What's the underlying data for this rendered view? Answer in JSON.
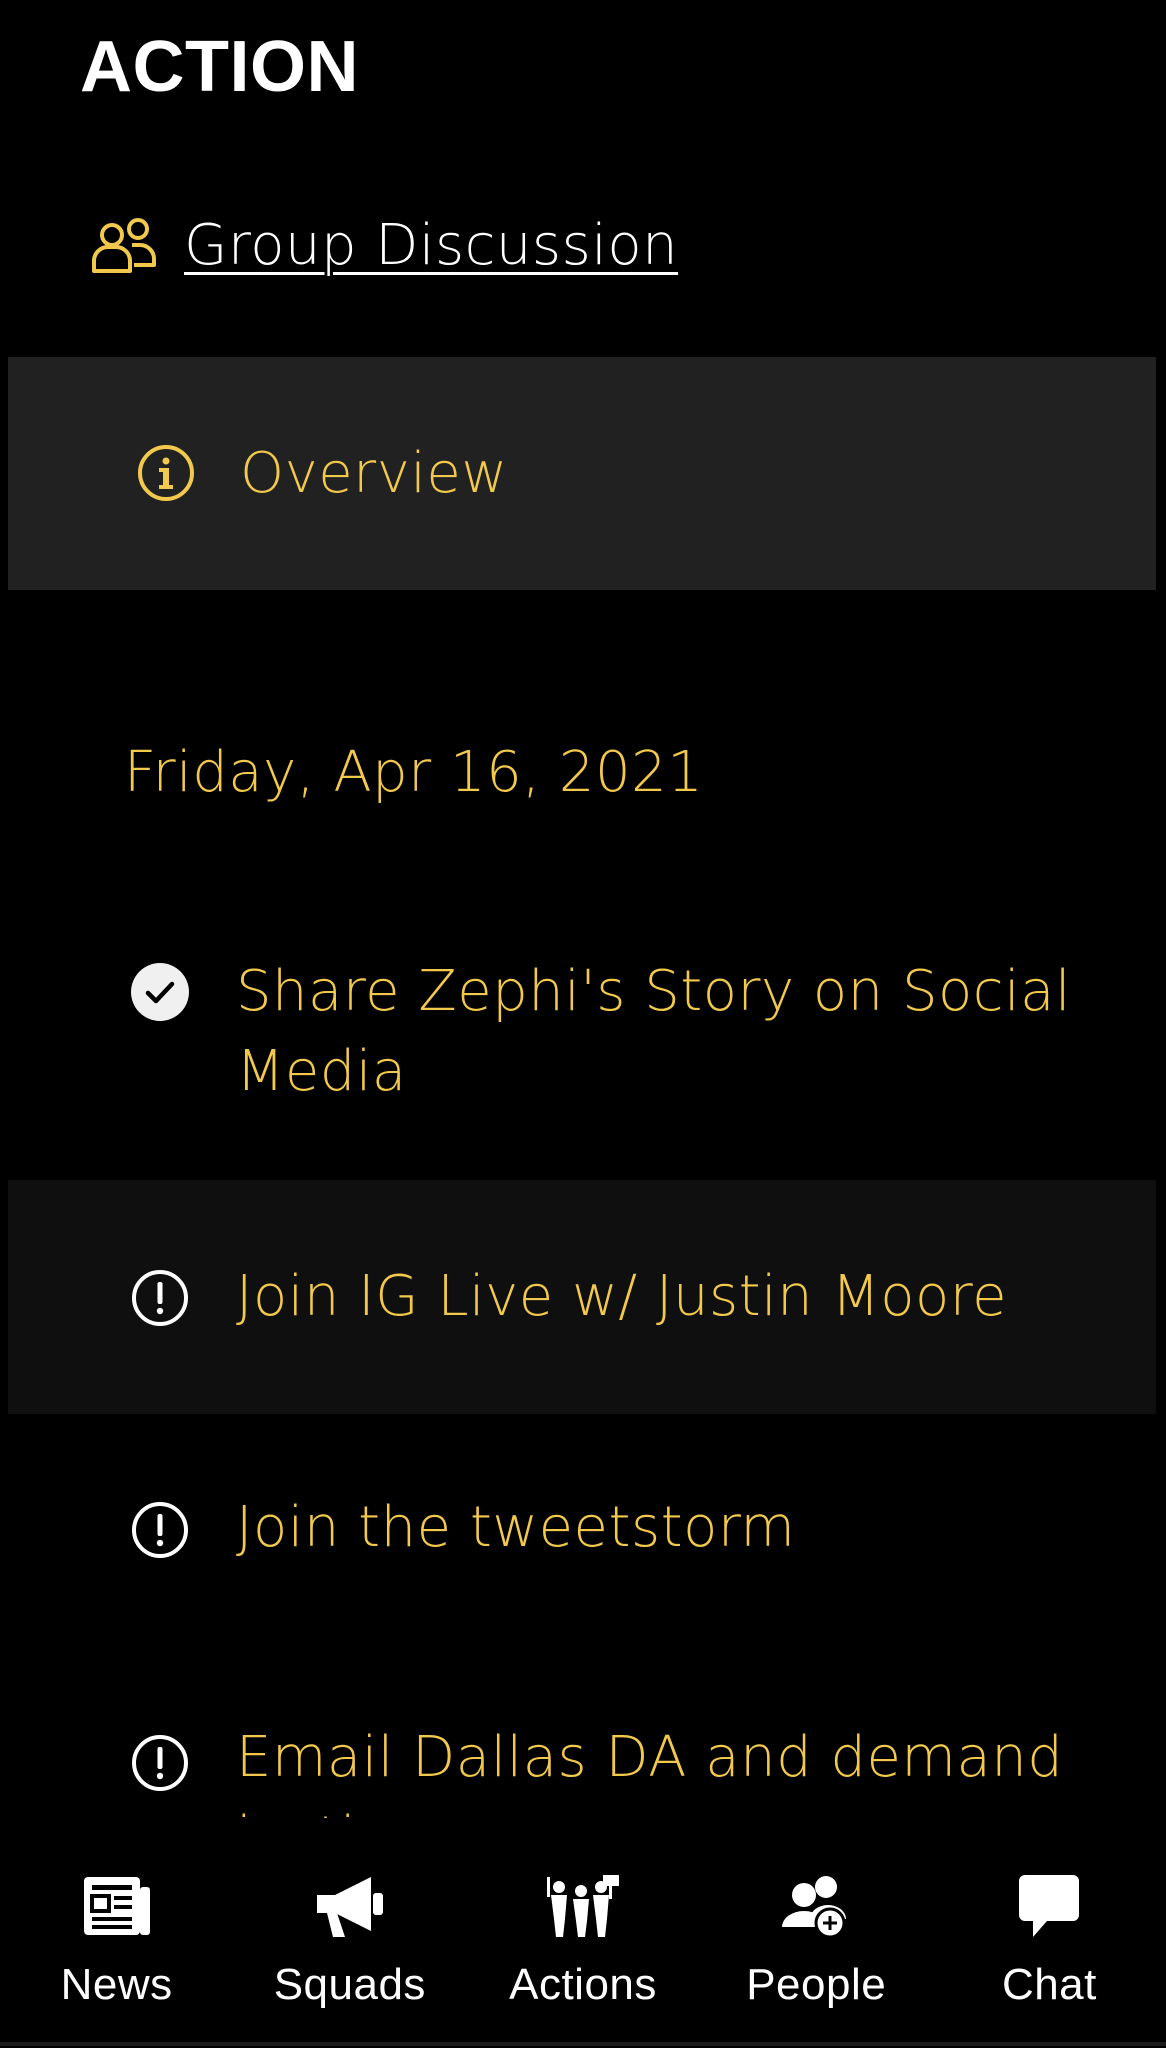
{
  "header": {
    "title": "ACTION"
  },
  "group_link": {
    "label": "Group Discussion",
    "icon": "users-icon"
  },
  "overview": {
    "label": "Overview",
    "icon": "info-icon"
  },
  "date_heading": "Friday, Apr 16, 2021",
  "actions": [
    {
      "label": "Share Zephi's Story on Social Media",
      "status": "completed",
      "icon": "check-circle-icon"
    },
    {
      "label": "Join IG Live w/ Justin Moore",
      "status": "pending",
      "icon": "alert-circle-icon"
    },
    {
      "label": "Join the tweetstorm",
      "status": "pending",
      "icon": "alert-circle-icon"
    },
    {
      "label": "Email Dallas DA and demand justice",
      "status": "pending",
      "icon": "alert-circle-icon"
    }
  ],
  "tab_bar": {
    "tabs": [
      {
        "label": "News",
        "icon": "newspaper-icon"
      },
      {
        "label": "Squads",
        "icon": "megaphone-icon"
      },
      {
        "label": "Actions",
        "icon": "protest-group-icon"
      },
      {
        "label": "People",
        "icon": "user-add-icon"
      },
      {
        "label": "Chat",
        "icon": "chat-bubble-icon"
      }
    ]
  },
  "colors": {
    "accent": "#f2c94c",
    "background": "#000000",
    "overview_bg": "#212121",
    "highlight_bg": "#0f0f0f",
    "text_primary": "#ffffff"
  }
}
